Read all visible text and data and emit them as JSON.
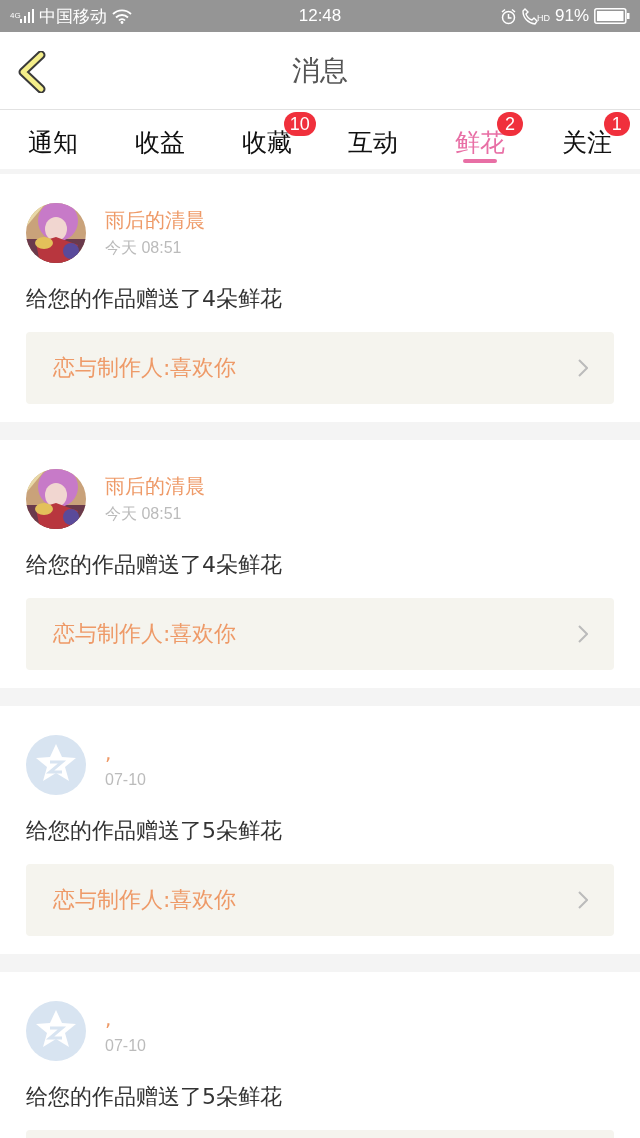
{
  "status_bar": {
    "network": "4G",
    "carrier": "中国移动",
    "time": "12:48",
    "call_label": "HD",
    "battery": "91%"
  },
  "header": {
    "title": "消息"
  },
  "tabs": [
    {
      "label": "通知",
      "selected": false
    },
    {
      "label": "收益",
      "selected": false
    },
    {
      "label": "收藏",
      "selected": false,
      "badge": "10"
    },
    {
      "label": "互动",
      "selected": false
    },
    {
      "label": "鲜花",
      "selected": true,
      "badge": "2"
    },
    {
      "label": "关注",
      "selected": false,
      "badge": "1"
    }
  ],
  "messages": [
    {
      "name": "雨后的清晨",
      "time": "今天 08:51",
      "text": "给您的作品赠送了4朵鲜花",
      "link": "恋与制作人:喜欢你"
    },
    {
      "name": "雨后的清晨",
      "time": "今天 08:51",
      "text": "给您的作品赠送了4朵鲜花",
      "link": "恋与制作人:喜欢你"
    },
    {
      "avatar": {
        "kind": "default"
      },
      "name": ",",
      "time": "07-10",
      "text": "给您的作品赠送了5朵鲜花",
      "link": "恋与制作人:喜欢你"
    },
    {
      "avatar": {
        "kind": "default"
      },
      "name": ",",
      "time": "07-10",
      "text": "给您的作品赠送了5朵鲜花"
    }
  ]
}
